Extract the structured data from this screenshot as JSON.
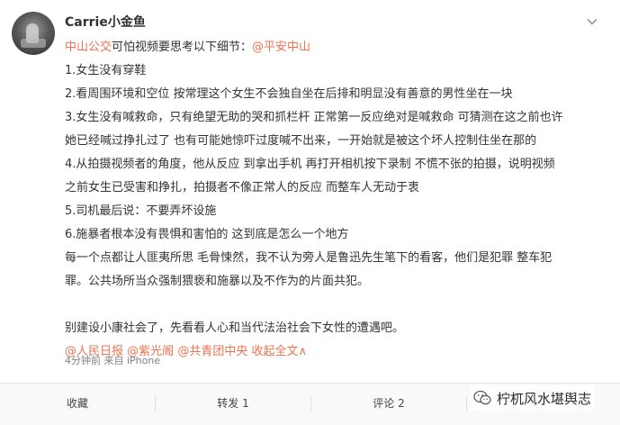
{
  "post": {
    "username": "Carrie小金鱼",
    "lines": [
      [
        {
          "t": "中山公交",
          "link": true
        },
        {
          "t": "可怕视频要思考以下细节：",
          "link": false
        },
        {
          "t": "@平安中山",
          "link": true
        }
      ],
      [
        {
          "t": "1.女生没有穿鞋",
          "link": false
        }
      ],
      [
        {
          "t": "2.看周围环境和空位 按常理这个女生不会独自坐在后排和明显没有善意的男性坐在一块",
          "link": false
        }
      ],
      [
        {
          "t": "3.女生没有喊救命，只有绝望无助的哭和抓栏杆 正常第一反应绝对是喊救命 可猜测在这之前也许",
          "link": false
        }
      ],
      [
        {
          "t": "她已经喊过挣扎过了 也有可能她惊吓过度喊不出来，一开始就是被这个坏人控制住坐在那的",
          "link": false
        }
      ],
      [
        {
          "t": "4.从拍摄视频者的角度，他从反应 到拿出手机 再打开相机按下录制 不慌不张的拍摄，说明视频",
          "link": false
        }
      ],
      [
        {
          "t": "之前女生已受害和挣扎，拍摄者不像正常人的反应 而整车人无动于衷",
          "link": false
        }
      ],
      [
        {
          "t": "5.司机最后说：不要弄坏设施",
          "link": false
        }
      ],
      [
        {
          "t": "6.施暴者根本没有畏惧和害怕的 这到底是怎么一个地方",
          "link": false
        }
      ],
      [
        {
          "t": "每一个点都让人匪夷所思 毛骨悚然，我不认为旁人是鲁迅先生笔下的看客，他们是犯罪 整车犯",
          "link": false
        }
      ],
      [
        {
          "t": "罪。公共场所当众强制猥亵和施暴以及不作为的片面共犯。",
          "link": false
        }
      ],
      [
        {
          "t": "",
          "link": false
        }
      ],
      [
        {
          "t": "别建设小康社会了，先看看人心和当代法治社会下女性的遭遇吧。",
          "link": false
        }
      ],
      [
        {
          "t": "@人民日报",
          "link": true
        },
        {
          "t": " ",
          "link": false
        },
        {
          "t": "@紫光阁",
          "link": true
        },
        {
          "t": " ",
          "link": false
        },
        {
          "t": "@共青团中央",
          "link": true
        },
        {
          "t": " ",
          "link": false
        },
        {
          "t": "收起全文",
          "link": true
        },
        {
          "t": "∧",
          "link": true
        }
      ]
    ],
    "time_source": "4分钟前 来自 iPhone"
  },
  "actions": {
    "favorite": "收藏",
    "repost": "转发 1",
    "comment": "评论 2"
  },
  "watermark": "柠杌风水堪舆志",
  "colors": {
    "link": "#eb7350",
    "text": "#333333",
    "meta": "#808080"
  },
  "icons": {
    "more": "chevron-down-icon",
    "watermark": "wechat-icon"
  }
}
